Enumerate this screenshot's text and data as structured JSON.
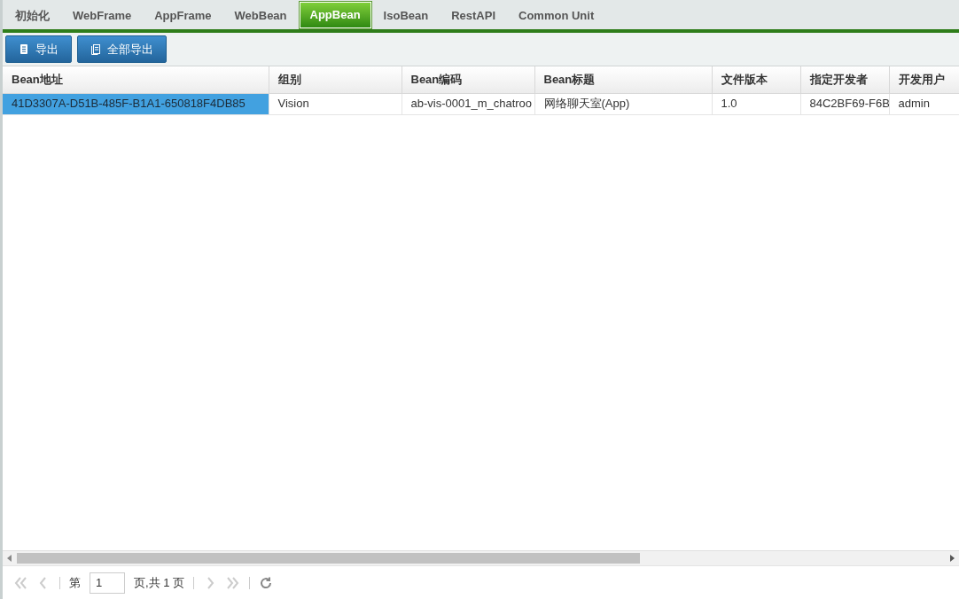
{
  "tabs": [
    {
      "label": "初始化",
      "selected": false
    },
    {
      "label": "WebFrame",
      "selected": false
    },
    {
      "label": "AppFrame",
      "selected": false
    },
    {
      "label": "WebBean",
      "selected": false
    },
    {
      "label": "AppBean",
      "selected": true
    },
    {
      "label": "IsoBean",
      "selected": false
    },
    {
      "label": "RestAPI",
      "selected": false
    },
    {
      "label": "Common Unit",
      "selected": false
    }
  ],
  "toolbar": [
    {
      "label": "导出",
      "kind": "page"
    },
    {
      "label": "全部导出",
      "kind": "pages"
    }
  ],
  "table": {
    "columns": [
      "Bean地址",
      "组别",
      "Bean编码",
      "Bean标题",
      "文件版本",
      "指定开发者",
      "开发用户"
    ],
    "rows": [
      {
        "cells": [
          {
            "text": "41D3307A-D51B-485F-B1A1-650818F4DB85",
            "selected": true
          },
          {
            "text": "Vision",
            "selected": false
          },
          {
            "text": "ab-vis-0001_m_chatroo",
            "selected": false
          },
          {
            "text": "网络聊天室(App)",
            "selected": false
          },
          {
            "text": "1.0",
            "selected": false
          },
          {
            "text": "84C2BF69-F6B",
            "selected": false
          },
          {
            "text": "admin",
            "selected": false
          }
        ]
      }
    ]
  },
  "pager": {
    "page_label": "第",
    "page": "1",
    "total_label": "页,共 1 页"
  }
}
